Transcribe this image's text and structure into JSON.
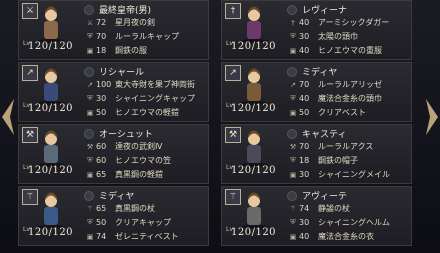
{
  "nav": {
    "prev_icon": "chevron-left",
    "next_icon": "chevron-right",
    "color": "#b8a27a"
  },
  "units": [
    {
      "name": "最終皇帝(男)",
      "job_icon": "sword",
      "level": "120/120",
      "equipment": [
        {
          "icon": "sword",
          "value": "72",
          "name": "星月夜の剣"
        },
        {
          "icon": "shield",
          "value": "70",
          "name": "ルーラルキャップ"
        },
        {
          "icon": "armor",
          "value": "18",
          "name": "鋼鉄の服"
        }
      ]
    },
    {
      "name": "レヴィーナ",
      "job_icon": "dagger",
      "level": "120/120",
      "equipment": [
        {
          "icon": "dagger",
          "value": "40",
          "name": "アーミシックダガー"
        },
        {
          "icon": "shield",
          "value": "30",
          "name": "太陽の頭巾"
        },
        {
          "icon": "armor",
          "value": "40",
          "name": "ヒノエウマの重服"
        }
      ]
    },
    {
      "name": "リシャール",
      "job_icon": "spear",
      "level": "120/120",
      "equipment": [
        {
          "icon": "spear",
          "value": "100",
          "name": "東大寺財を果ブ神両街"
        },
        {
          "icon": "shield",
          "value": "30",
          "name": "シャイニングキャップ"
        },
        {
          "icon": "armor",
          "value": "50",
          "name": "ヒノエウマの軽鎧"
        }
      ]
    },
    {
      "name": "ミディヤ",
      "job_icon": "spear",
      "level": "120/120",
      "equipment": [
        {
          "icon": "spear",
          "value": "70",
          "name": "ルーラルアリッゼ"
        },
        {
          "icon": "shield",
          "value": "40",
          "name": "魔法合金糸の頭巾"
        },
        {
          "icon": "armor",
          "value": "50",
          "name": "クリアベスト"
        }
      ]
    },
    {
      "name": "オーシュット",
      "job_icon": "axe",
      "level": "120/120",
      "equipment": [
        {
          "icon": "axe",
          "value": "60",
          "name": "達夜の武剣Ⅳ"
        },
        {
          "icon": "shield",
          "value": "60",
          "name": "ヒノエウマの笠"
        },
        {
          "icon": "armor",
          "value": "65",
          "name": "真黒鋼の軽鎧"
        }
      ]
    },
    {
      "name": "キャスティ",
      "job_icon": "axe",
      "level": "120/120",
      "equipment": [
        {
          "icon": "axe",
          "value": "70",
          "name": "ルーラルアクス"
        },
        {
          "icon": "shield",
          "value": "18",
          "name": "鋼鉄の帽子"
        },
        {
          "icon": "armor",
          "value": "30",
          "name": "シャイニングメイル"
        }
      ]
    },
    {
      "name": "ミディヤ",
      "job_icon": "staff",
      "level": "120/120",
      "equipment": [
        {
          "icon": "staff",
          "value": "65",
          "name": "真黒鋼の杖"
        },
        {
          "icon": "shield",
          "value": "50",
          "name": "クリアキャップ"
        },
        {
          "icon": "armor",
          "value": "74",
          "name": "ゼレニティベスト"
        }
      ]
    },
    {
      "name": "アヴィーテ",
      "job_icon": "staff",
      "level": "120/120",
      "equipment": [
        {
          "icon": "staff",
          "value": "74",
          "name": "静謐の杖"
        },
        {
          "icon": "shield",
          "value": "30",
          "name": "シャイニングヘルム"
        },
        {
          "icon": "armor",
          "value": "40",
          "name": "魔法合金糸の衣"
        }
      ]
    }
  ]
}
